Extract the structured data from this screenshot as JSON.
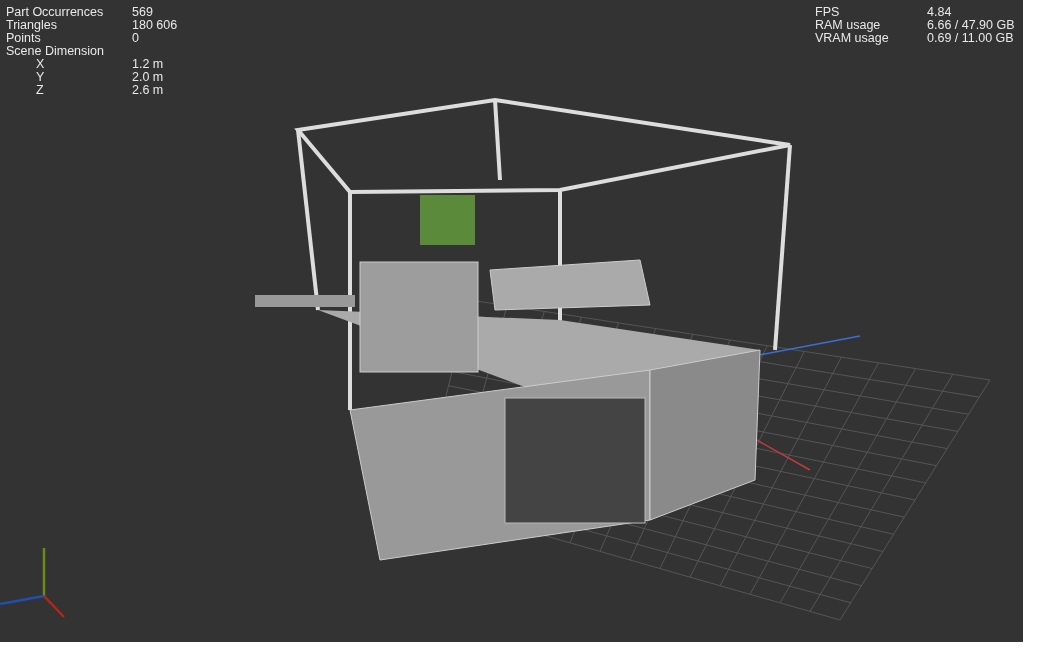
{
  "scene_stats": [
    {
      "label": "Part Occurrences",
      "value": "569"
    },
    {
      "label": "Triangles",
      "value": "180 606"
    },
    {
      "label": "Points",
      "value": "0"
    },
    {
      "label": "Scene Dimension",
      "children": [
        {
          "label": "X",
          "value": "1.2 m"
        },
        {
          "label": "Y",
          "value": "2.0 m"
        },
        {
          "label": "Z",
          "value": "2.6 m"
        }
      ]
    }
  ],
  "performance_stats": [
    {
      "label": "FPS",
      "value": "4.84"
    },
    {
      "label": "RAM usage",
      "value": "6.66 / 47.90 GB"
    },
    {
      "label": "VRAM usage",
      "value": "0.69 / 11.00 GB"
    }
  ]
}
